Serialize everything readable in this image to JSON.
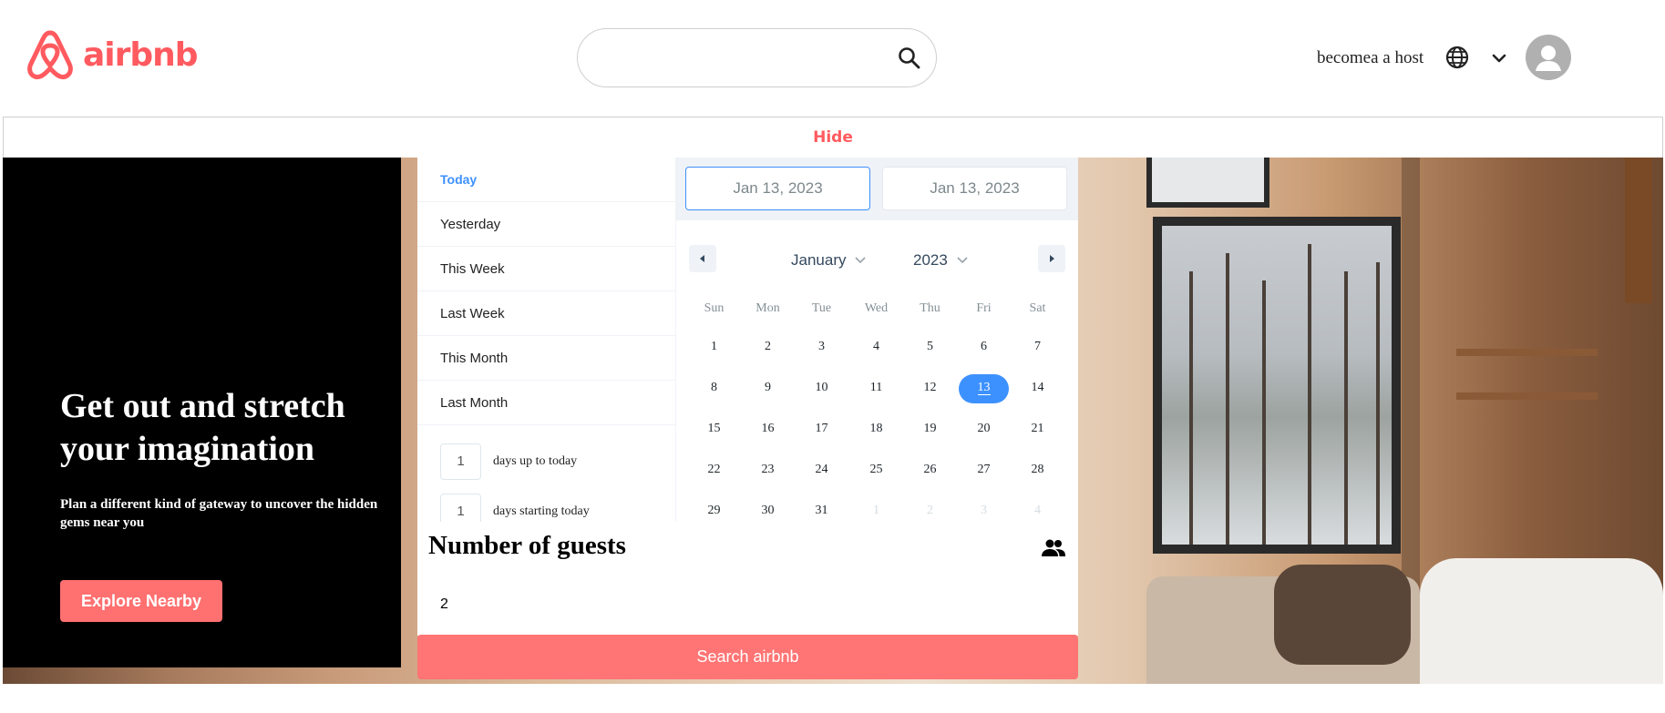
{
  "header": {
    "logo_text": "airbnb",
    "search_placeholder": "",
    "host_link": "becomea a host",
    "icons": [
      "search-icon",
      "globe-icon",
      "chevron-down-icon",
      "avatar-icon"
    ]
  },
  "hide_bar": {
    "label": "Hide"
  },
  "hero": {
    "title": "Get out and stretch your imagination",
    "subtitle": "Plan a different kind of gateway to uncover the hidden gems near you",
    "explore_label": "Explore Nearby"
  },
  "date_picker": {
    "static_ranges": [
      "Today",
      "Yesterday",
      "This Week",
      "Last Week",
      "This Month",
      "Last Month"
    ],
    "active_range": "Today",
    "input_ranges": [
      {
        "value": "1",
        "label": "days up to today"
      },
      {
        "value": "1",
        "label": "days starting today"
      }
    ],
    "start_date": "Jan 13, 2023",
    "end_date": "Jan 13, 2023",
    "month": "January",
    "year": "2023",
    "weekdays": [
      "Sun",
      "Mon",
      "Tue",
      "Wed",
      "Thu",
      "Fri",
      "Sat"
    ],
    "weeks": [
      [
        "1",
        "2",
        "3",
        "4",
        "5",
        "6",
        "7"
      ],
      [
        "8",
        "9",
        "10",
        "11",
        "12",
        "13",
        "14"
      ],
      [
        "15",
        "16",
        "17",
        "18",
        "19",
        "20",
        "21"
      ],
      [
        "22",
        "23",
        "24",
        "25",
        "26",
        "27",
        "28"
      ],
      [
        "29",
        "30",
        "31",
        "1",
        "2",
        "3",
        "4"
      ]
    ],
    "selected_day": "13",
    "accent_color": "#3d91ff"
  },
  "guests": {
    "title": "Number of guests",
    "value": "2",
    "icon": "people-icon"
  },
  "search_button": {
    "label": "Search airbnb"
  },
  "colors": {
    "brand": "#ff5a5f",
    "button": "#ff7474"
  }
}
